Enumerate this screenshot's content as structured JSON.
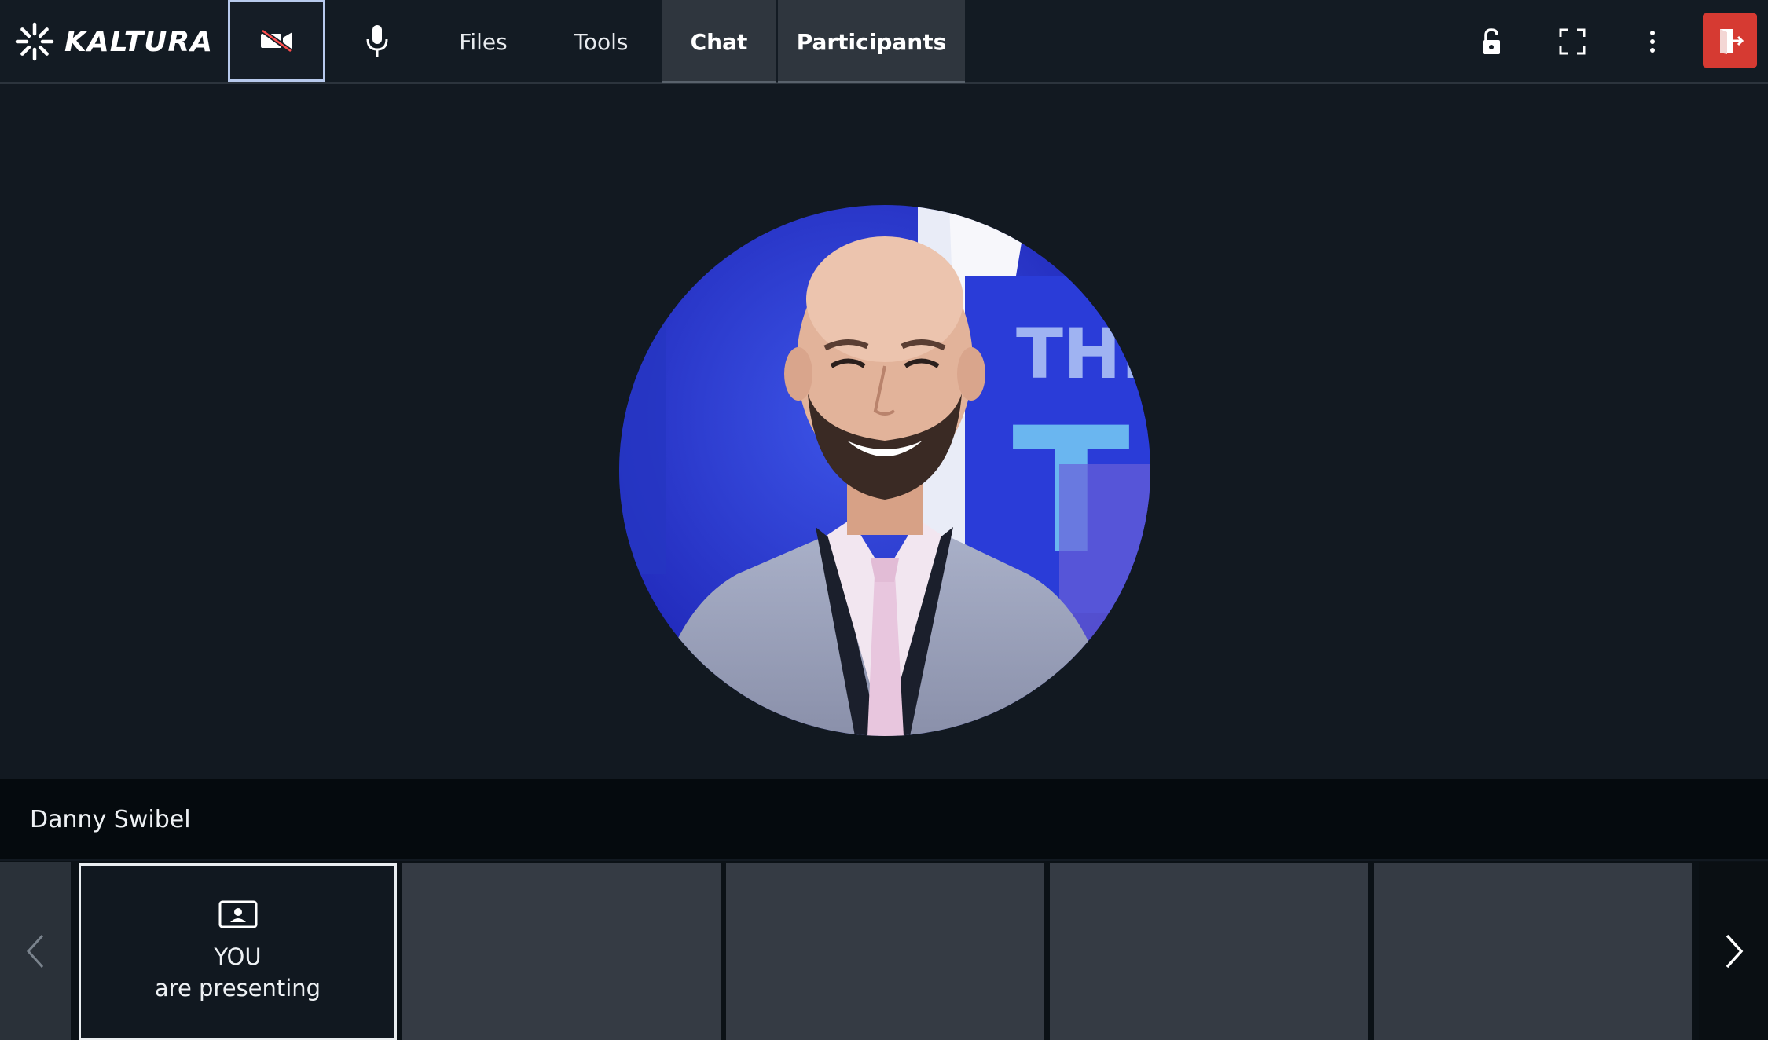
{
  "brand": {
    "name": "KALTURA"
  },
  "toolbar": {
    "camera_icon": "camera-off-icon",
    "mic_icon": "microphone-icon",
    "tabs": [
      {
        "label": "Files",
        "active": false
      },
      {
        "label": "Tools",
        "active": false
      },
      {
        "label": "Chat",
        "active": true
      },
      {
        "label": "Participants",
        "active": true
      }
    ],
    "right_icons": [
      "unlock-icon",
      "fullscreen-icon",
      "more-vertical-icon",
      "exit-icon"
    ]
  },
  "stage": {
    "presenter_name": "Danny Swibel"
  },
  "strip": {
    "self_tile": {
      "line1": "YOU",
      "line2": "are presenting",
      "icon": "presenter-card-icon"
    },
    "empty_tiles": 4
  },
  "colors": {
    "background": "#121921",
    "topbar": "#131b23",
    "active_tab": "#2f363e",
    "camera_focus_border": "#b7c9ec",
    "exit_button": "#d63a32",
    "name_bar": "#050a0e",
    "empty_tile": "#353b44"
  }
}
